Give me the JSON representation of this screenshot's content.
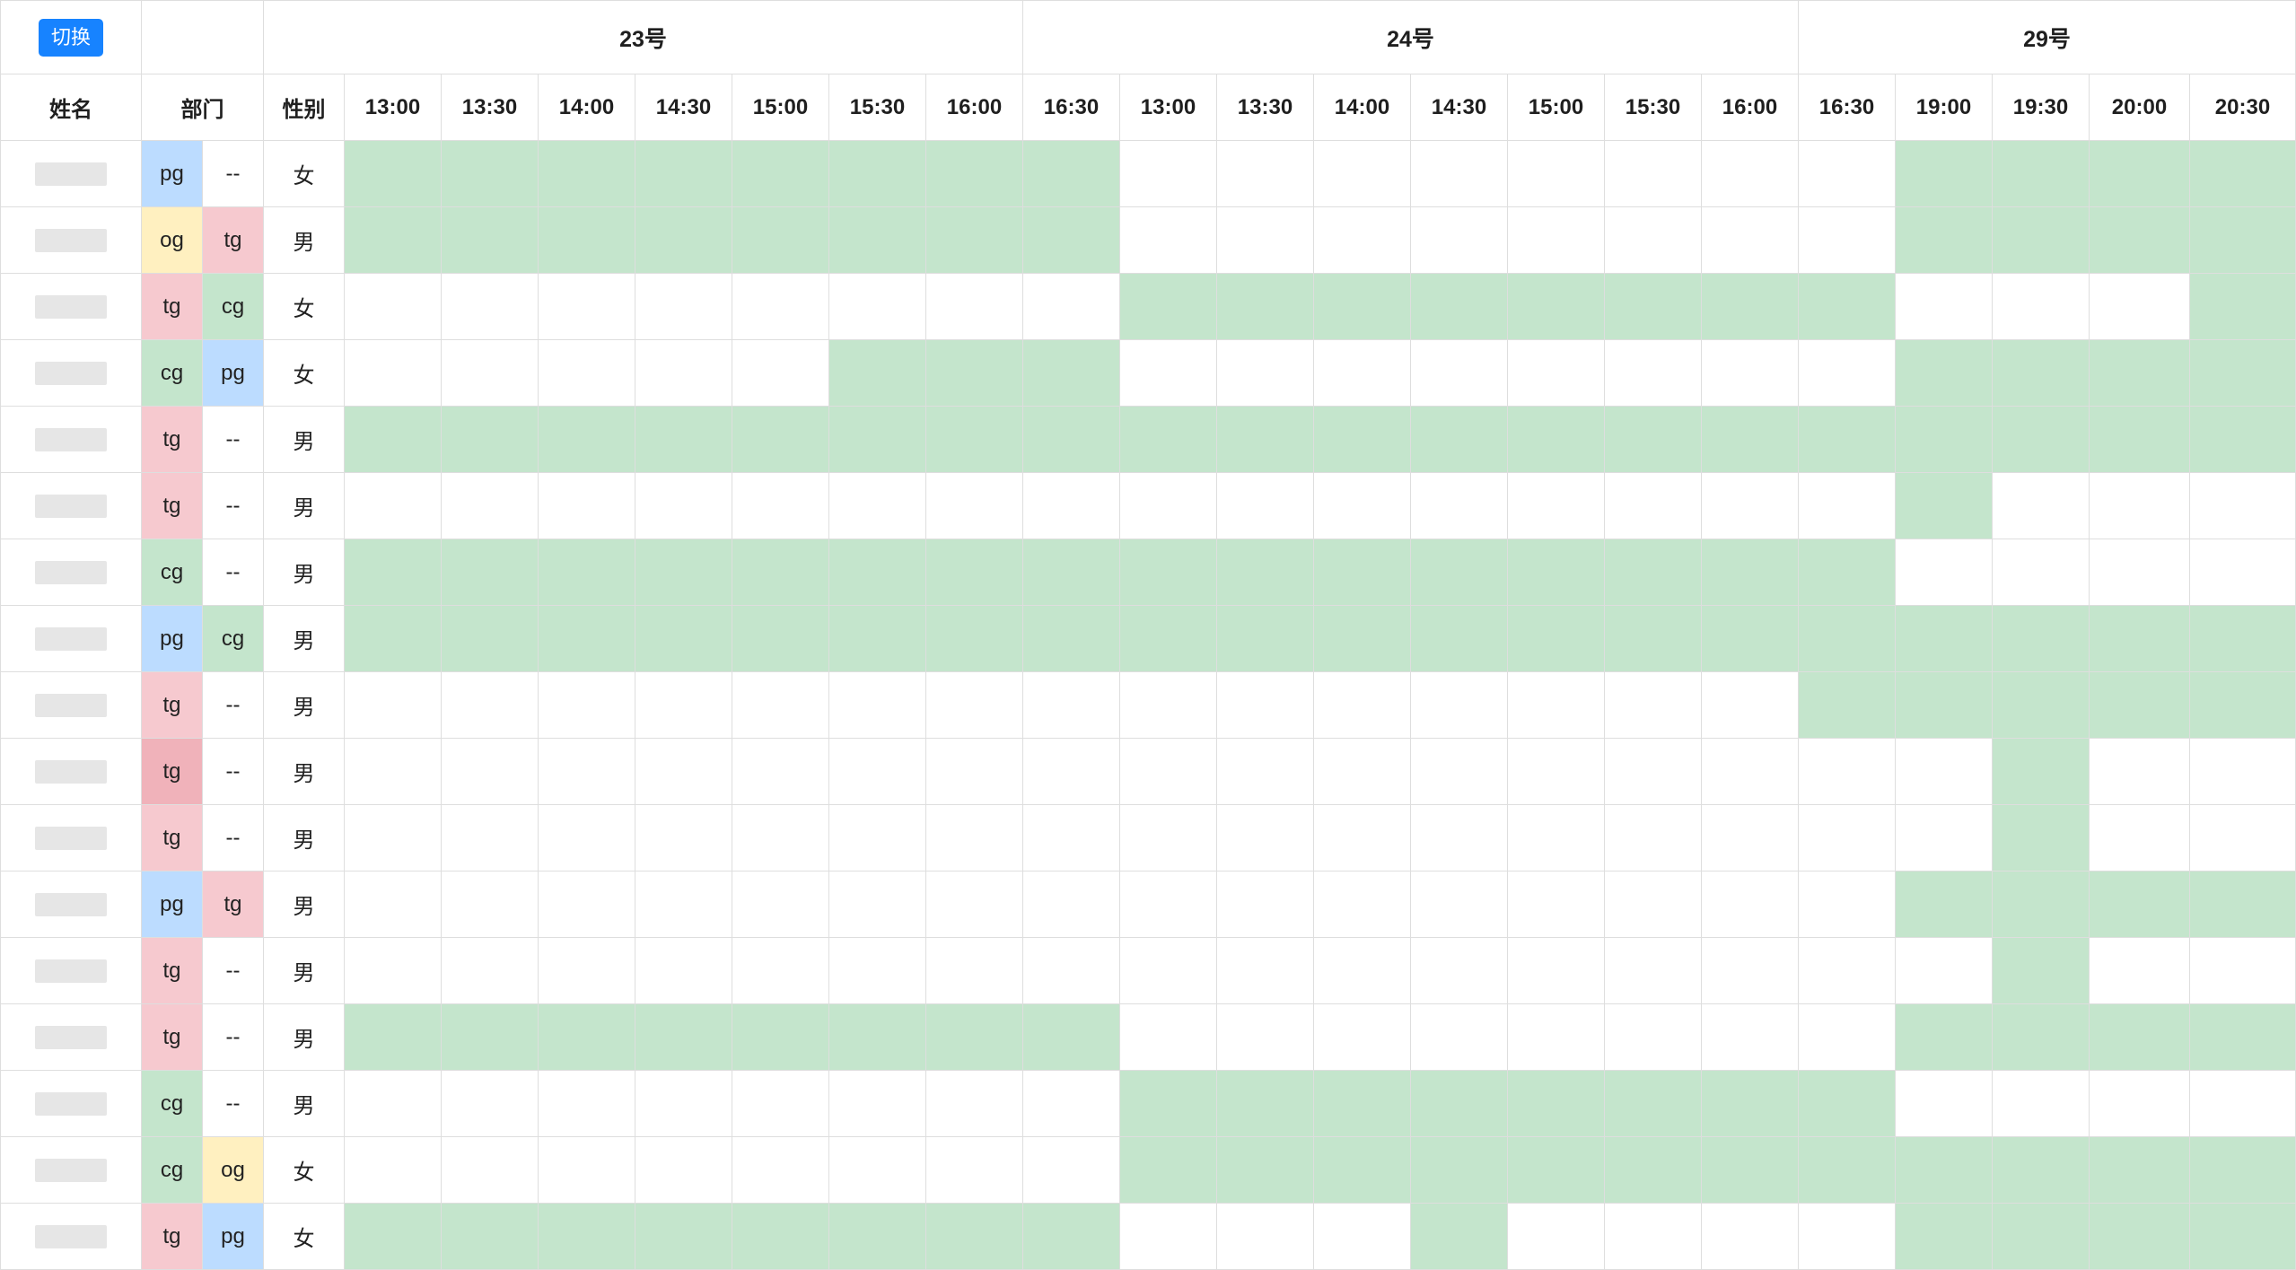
{
  "toggle_button": "切换",
  "headers": {
    "name": "姓名",
    "dept": "部门",
    "gender": "性别"
  },
  "days": [
    "23号",
    "24号",
    "29号"
  ],
  "time_slots": [
    "13:00",
    "13:30",
    "14:00",
    "14:30",
    "15:00",
    "15:30",
    "16:00",
    "16:30",
    "13:00",
    "13:30",
    "14:00",
    "14:30",
    "15:00",
    "15:30",
    "16:00",
    "16:30",
    "19:00",
    "19:30",
    "20:00",
    "20:30"
  ],
  "dept_colors": {
    "pg": "#bcdcff",
    "og": "#fff0c0",
    "tg": "#f6c9cf",
    "cg": "#c4e5cc",
    "--": "#ffffff"
  },
  "available_color": "#c4e5cc",
  "rows": [
    {
      "dept1": "pg",
      "dept2": "--",
      "gender": "女",
      "avail": [
        1,
        1,
        1,
        1,
        1,
        1,
        1,
        1,
        0,
        0,
        0,
        0,
        0,
        0,
        0,
        0,
        1,
        1,
        1,
        1
      ]
    },
    {
      "dept1": "og",
      "dept2": "tg",
      "gender": "男",
      "avail": [
        1,
        1,
        1,
        1,
        1,
        1,
        1,
        1,
        0,
        0,
        0,
        0,
        0,
        0,
        0,
        0,
        1,
        1,
        1,
        1
      ]
    },
    {
      "dept1": "tg",
      "dept2": "cg",
      "gender": "女",
      "avail": [
        0,
        0,
        0,
        0,
        0,
        0,
        0,
        0,
        1,
        1,
        1,
        1,
        1,
        1,
        1,
        1,
        0,
        0,
        0,
        1
      ]
    },
    {
      "dept1": "cg",
      "dept2": "pg",
      "gender": "女",
      "avail": [
        0,
        0,
        0,
        0,
        0,
        1,
        1,
        1,
        0,
        0,
        0,
        0,
        0,
        0,
        0,
        0,
        1,
        1,
        1,
        1
      ]
    },
    {
      "dept1": "tg",
      "dept2": "--",
      "gender": "男",
      "avail": [
        1,
        1,
        1,
        1,
        1,
        1,
        1,
        1,
        1,
        1,
        1,
        1,
        1,
        1,
        1,
        1,
        1,
        1,
        1,
        1
      ]
    },
    {
      "dept1": "tg",
      "dept2": "--",
      "gender": "男",
      "avail": [
        0,
        0,
        0,
        0,
        0,
        0,
        0,
        0,
        0,
        0,
        0,
        0,
        0,
        0,
        0,
        0,
        1,
        0,
        0,
        0
      ]
    },
    {
      "dept1": "cg",
      "dept2": "--",
      "gender": "男",
      "avail": [
        1,
        1,
        1,
        1,
        1,
        1,
        1,
        1,
        1,
        1,
        1,
        1,
        1,
        1,
        1,
        1,
        0,
        0,
        0,
        0
      ]
    },
    {
      "dept1": "pg",
      "dept2": "cg",
      "gender": "男",
      "avail": [
        1,
        1,
        1,
        1,
        1,
        1,
        1,
        1,
        1,
        1,
        1,
        1,
        1,
        1,
        1,
        1,
        1,
        1,
        1,
        1
      ]
    },
    {
      "dept1": "tg",
      "dept2": "--",
      "gender": "男",
      "avail": [
        0,
        0,
        0,
        0,
        0,
        0,
        0,
        0,
        0,
        0,
        0,
        0,
        0,
        0,
        0,
        1,
        1,
        1,
        1,
        1
      ]
    },
    {
      "dept1": "tg",
      "dept2": "--",
      "gender": "男",
      "avail": [
        0,
        0,
        0,
        0,
        0,
        0,
        0,
        0,
        0,
        0,
        0,
        0,
        0,
        0,
        0,
        0,
        0,
        1,
        0,
        0
      ],
      "dept1_color": "#f0b2ba"
    },
    {
      "dept1": "tg",
      "dept2": "--",
      "gender": "男",
      "avail": [
        0,
        0,
        0,
        0,
        0,
        0,
        0,
        0,
        0,
        0,
        0,
        0,
        0,
        0,
        0,
        0,
        0,
        1,
        0,
        0
      ]
    },
    {
      "dept1": "pg",
      "dept2": "tg",
      "gender": "男",
      "avail": [
        0,
        0,
        0,
        0,
        0,
        0,
        0,
        0,
        0,
        0,
        0,
        0,
        0,
        0,
        0,
        0,
        1,
        1,
        1,
        1
      ]
    },
    {
      "dept1": "tg",
      "dept2": "--",
      "gender": "男",
      "avail": [
        0,
        0,
        0,
        0,
        0,
        0,
        0,
        0,
        0,
        0,
        0,
        0,
        0,
        0,
        0,
        0,
        0,
        1,
        0,
        0
      ]
    },
    {
      "dept1": "tg",
      "dept2": "--",
      "gender": "男",
      "avail": [
        1,
        1,
        1,
        1,
        1,
        1,
        1,
        1,
        0,
        0,
        0,
        0,
        0,
        0,
        0,
        0,
        1,
        1,
        1,
        1
      ]
    },
    {
      "dept1": "cg",
      "dept2": "--",
      "gender": "男",
      "avail": [
        0,
        0,
        0,
        0,
        0,
        0,
        0,
        0,
        1,
        1,
        1,
        1,
        1,
        1,
        1,
        1,
        0,
        0,
        0,
        0
      ]
    },
    {
      "dept1": "cg",
      "dept2": "og",
      "gender": "女",
      "avail": [
        0,
        0,
        0,
        0,
        0,
        0,
        0,
        0,
        1,
        1,
        1,
        1,
        1,
        1,
        1,
        1,
        1,
        1,
        1,
        1
      ]
    },
    {
      "dept1": "tg",
      "dept2": "pg",
      "gender": "女",
      "avail": [
        1,
        1,
        1,
        1,
        1,
        1,
        1,
        1,
        0,
        0,
        0,
        1,
        0,
        0,
        0,
        0,
        1,
        1,
        1,
        1
      ]
    }
  ]
}
